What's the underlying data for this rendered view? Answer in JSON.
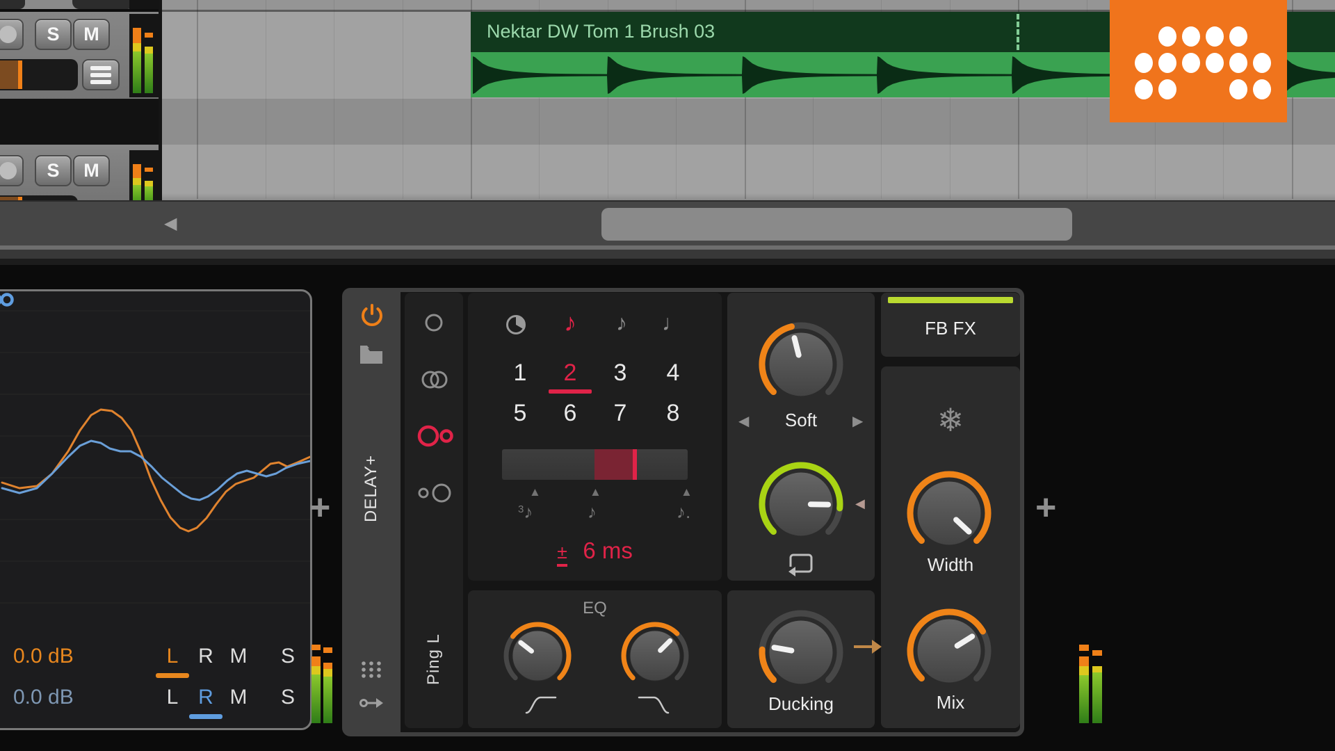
{
  "arrangement": {
    "clip_name": "Nektar DW Tom 1 Brush 03",
    "clip_hits": [
      3,
      197,
      391,
      585,
      779,
      973,
      1167
    ]
  },
  "track_header": {
    "solo": "S",
    "mute": "M"
  },
  "icons": {
    "scroll_arrow": "◀",
    "left_arrow": "◀",
    "right_arrow": "▶",
    "up_triangle": "▲",
    "eighth_note": "♪",
    "quarter_note": "♩",
    "snowflake": "❄",
    "plus": "+",
    "mod_marker": "◀"
  },
  "scope": {
    "gain_top": "0.0 dB",
    "gain_bottom": "0.0 dB",
    "rows": [
      {
        "letters": [
          "L",
          "R",
          "M",
          "S"
        ],
        "active": 0,
        "active_color": "#e8871e"
      },
      {
        "letters": [
          "L",
          "R",
          "M",
          "S"
        ],
        "active": 1,
        "active_color": "#5f9de0"
      }
    ],
    "curves": {
      "orange": {
        "color": "#e0832e",
        "points": [
          [
            24,
            275
          ],
          [
            49,
            283
          ],
          [
            74,
            280
          ],
          [
            96,
            262
          ],
          [
            119,
            230
          ],
          [
            136,
            200
          ],
          [
            152,
            178
          ],
          [
            166,
            170
          ],
          [
            182,
            172
          ],
          [
            196,
            182
          ],
          [
            210,
            200
          ],
          [
            224,
            232
          ],
          [
            238,
            270
          ],
          [
            252,
            300
          ],
          [
            266,
            325
          ],
          [
            280,
            340
          ],
          [
            292,
            345
          ],
          [
            304,
            340
          ],
          [
            318,
            326
          ],
          [
            332,
            306
          ],
          [
            346,
            288
          ],
          [
            360,
            277
          ],
          [
            374,
            272
          ],
          [
            386,
            268
          ],
          [
            398,
            258
          ],
          [
            410,
            248
          ],
          [
            422,
            246
          ],
          [
            434,
            252
          ],
          [
            449,
            246
          ],
          [
            467,
            238
          ]
        ]
      },
      "blue": {
        "color": "#6a9fd8",
        "points": [
          [
            24,
            283
          ],
          [
            49,
            290
          ],
          [
            74,
            283
          ],
          [
            96,
            262
          ],
          [
            119,
            238
          ],
          [
            136,
            222
          ],
          [
            152,
            215
          ],
          [
            166,
            218
          ],
          [
            179,
            226
          ],
          [
            194,
            230
          ],
          [
            209,
            230
          ],
          [
            224,
            238
          ],
          [
            239,
            252
          ],
          [
            254,
            268
          ],
          [
            269,
            280
          ],
          [
            284,
            292
          ],
          [
            296,
            298
          ],
          [
            308,
            300
          ],
          [
            320,
            295
          ],
          [
            334,
            285
          ],
          [
            348,
            272
          ],
          [
            362,
            262
          ],
          [
            376,
            258
          ],
          [
            390,
            262
          ],
          [
            404,
            266
          ],
          [
            418,
            262
          ],
          [
            432,
            254
          ],
          [
            449,
            248
          ],
          [
            467,
            244
          ]
        ]
      }
    }
  },
  "device": {
    "title": "DELAY+",
    "mode_label": "Ping L",
    "time_panel": {
      "numbers": [
        "1",
        "2",
        "3",
        "4",
        "5",
        "6",
        "7",
        "8"
      ],
      "selected_index": 1,
      "plusminus": "±",
      "offset": "6 ms",
      "triplet_digit": "3",
      "dot": "."
    },
    "eq_label": "EQ",
    "soft": {
      "label": "Soft"
    },
    "ducking_label": "Ducking",
    "width_label": "Width",
    "mix_label": "Mix",
    "fb_label": "FB FX"
  },
  "knobs": [
    {
      "name": "soft",
      "arc_color": "#f08418",
      "arc_start": -135,
      "arc_end": -14,
      "indicator": -14
    },
    {
      "name": "feedback",
      "arc_color": "#a9d414",
      "arc_start": -135,
      "arc_end": 96,
      "indicator": 91
    },
    {
      "name": "ducking",
      "arc_color": "#f08418",
      "arc_start": -135,
      "arc_end": -86,
      "indicator": -80
    },
    {
      "name": "width",
      "arc_color": "#f08418",
      "arc_start": -135,
      "arc_end": 135,
      "indicator": 133
    },
    {
      "name": "mix",
      "arc_color": "#f08418",
      "arc_start": -135,
      "arc_end": 60,
      "indicator": 58
    },
    {
      "name": "eq_low",
      "arc_color": "#f08418",
      "arc_start": -52,
      "arc_end": 135,
      "indicator": -52
    },
    {
      "name": "eq_high",
      "arc_color": "#f08418",
      "arc_start": -135,
      "arc_end": 45,
      "indicator": 45
    }
  ],
  "colors": {
    "accent_orange": "#f08418",
    "accent_red": "#e02348",
    "accent_lime": "#a9d414",
    "accent_blue": "#5f9de0",
    "logo_orange": "#f0741c",
    "clip_green": "#3aa251",
    "clip_header_green": "#11391d"
  }
}
